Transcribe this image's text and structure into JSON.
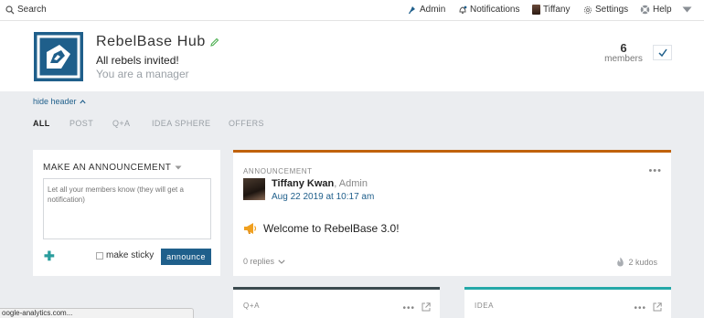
{
  "nav": {
    "search_label": "Search",
    "admin_label": "Admin",
    "notifications_label": "Notifications",
    "user_label": "Tiffany",
    "settings_label": "Settings",
    "help_label": "Help"
  },
  "hub": {
    "title": "RebelBase Hub",
    "subtitle": "All rebels invited!",
    "role": "You are a manager",
    "members_count": "6",
    "members_label": "members"
  },
  "filters": {
    "hide_header": "hide header",
    "items": [
      "ALL",
      "POST",
      "Q+A",
      "IDEA SPHERE",
      "OFFERS"
    ]
  },
  "composer": {
    "title": "MAKE AN ANNOUNCEMENT",
    "placeholder": "Let all your members know (they will get a notification)",
    "sticky_label": "make sticky",
    "announce_label": "announce"
  },
  "post": {
    "kind": "ANNOUNCEMENT",
    "author": "Tiffany Kwan",
    "author_role": ", Admin",
    "date": "Aug 22 2019 at 10:17 am",
    "headline": "Welcome to RebelBase 3.0!",
    "replies": "0 replies",
    "kudos": "2 kudos"
  },
  "cards": {
    "qa_kind": "Q+A",
    "idea_kind": "IDEA"
  },
  "status_bar": "oogle-analytics.com...",
  "colors": {
    "brand_blue": "#1f5f8b",
    "announcement_orange": "#c0620c",
    "idea_teal": "#25a8a8",
    "qa_dark": "#3b4a4f"
  }
}
